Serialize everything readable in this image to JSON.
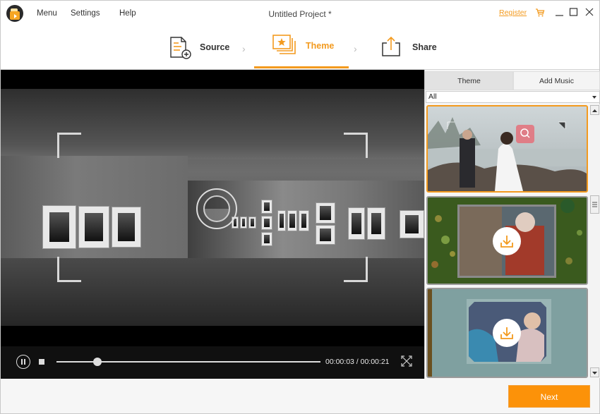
{
  "app": {
    "title": "Untitled Project *",
    "menus": [
      "Menu",
      "Settings",
      "Help"
    ],
    "register_label": "Register",
    "accent_color": "#f39a1e"
  },
  "steps": [
    {
      "label": "Source",
      "icon": "document-add-icon",
      "active": false
    },
    {
      "label": "Theme",
      "icon": "theme-slides-icon",
      "active": true
    },
    {
      "label": "Share",
      "icon": "share-export-icon",
      "active": false
    }
  ],
  "player": {
    "current_time": "00:00:03",
    "total_time": "00:00:21",
    "timecode": "00:00:03 / 00:00:21",
    "progress_fraction": 0.155
  },
  "panel": {
    "tabs": [
      {
        "label": "Theme",
        "active": true
      },
      {
        "label": "Add Music",
        "active": false
      }
    ],
    "filter": {
      "selected": "All"
    },
    "themes": [
      {
        "name": "wedding-theme",
        "state": "selected",
        "action_icon": "zoom-preview-icon"
      },
      {
        "name": "christmas-theme",
        "state": "download",
        "action_icon": "download-icon"
      },
      {
        "name": "family-theme",
        "state": "download",
        "action_icon": "download-icon"
      }
    ]
  },
  "footer": {
    "next_label": "Next"
  }
}
